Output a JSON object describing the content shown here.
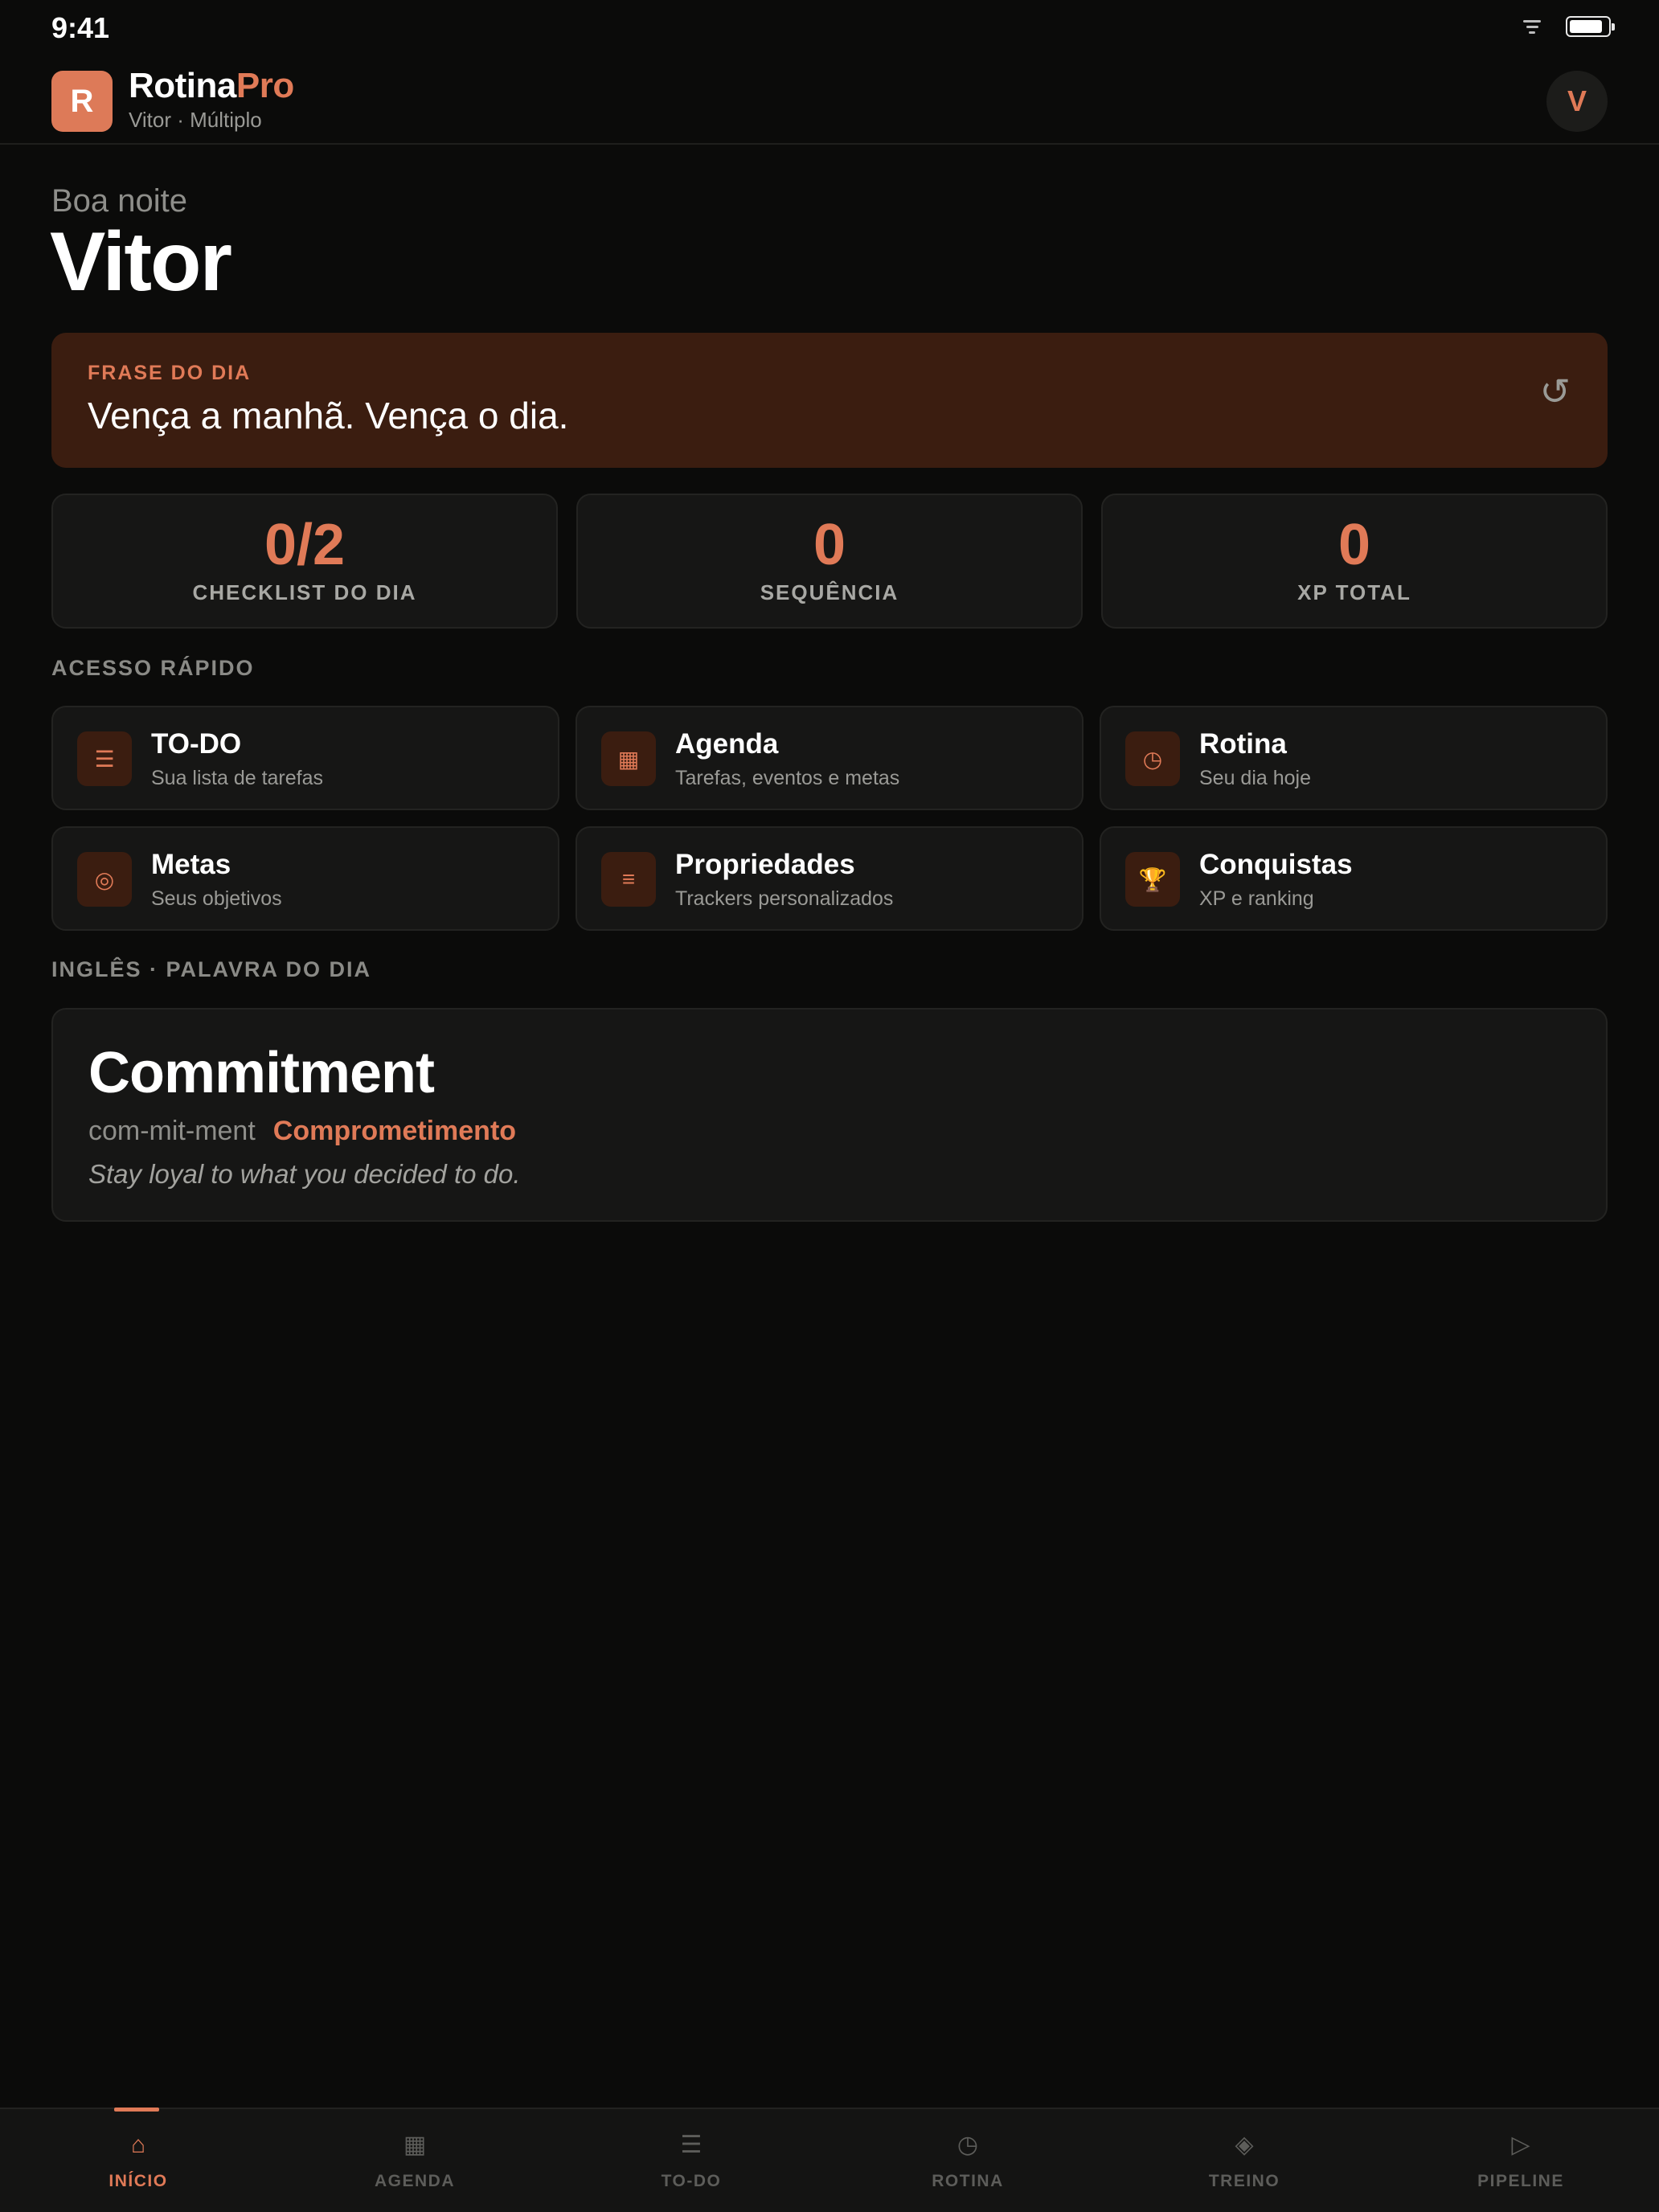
{
  "status_bar": {
    "time": "9:41"
  },
  "header": {
    "logo_letter": "R",
    "title_main": "Rotina",
    "title_accent": "Pro",
    "subtitle": "Vitor · Múltiplo",
    "avatar_letter": "V"
  },
  "greeting": {
    "salutation": "Boa noite",
    "name": "Vitor"
  },
  "quote": {
    "label": "FRASE DO DIA",
    "text": "Vença a manhã. Vença o dia.",
    "refresh_icon": "refresh-icon"
  },
  "stats": [
    {
      "value": "0/2",
      "label": "CHECKLIST DO DIA"
    },
    {
      "value": "0",
      "label": "SEQUÊNCIA"
    },
    {
      "value": "0",
      "label": "XP TOTAL"
    }
  ],
  "quick_access": {
    "label": "ACESSO RÁPIDO",
    "items": [
      {
        "title": "TO-DO",
        "subtitle": "Sua lista de tarefas",
        "icon": "☰"
      },
      {
        "title": "Agenda",
        "subtitle": "Tarefas, eventos e metas",
        "icon": "▦"
      },
      {
        "title": "Rotina",
        "subtitle": "Seu dia hoje",
        "icon": "◷"
      },
      {
        "title": "Metas",
        "subtitle": "Seus objetivos",
        "icon": "◎"
      },
      {
        "title": "Propriedades",
        "subtitle": "Trackers personalizados",
        "icon": "≡"
      },
      {
        "title": "Conquistas",
        "subtitle": "XP e ranking",
        "icon": "🏆"
      }
    ]
  },
  "word_of_day": {
    "label": "INGLÊS · PALAVRA DO DIA",
    "word": "Commitment",
    "pronunciation": "com-mit-ment",
    "translation": "Comprometimento",
    "example": "Stay loyal to what you decided to do."
  },
  "bottom_nav": {
    "active": "INÍCIO",
    "items": [
      {
        "label": "INÍCIO",
        "icon": "⌂"
      },
      {
        "label": "AGENDA",
        "icon": "▦"
      },
      {
        "label": "TO-DO",
        "icon": "☰"
      },
      {
        "label": "ROTINA",
        "icon": "◷"
      },
      {
        "label": "TREINO",
        "icon": "◈"
      },
      {
        "label": "PIPELINE",
        "icon": "▷"
      }
    ]
  },
  "colors": {
    "accent": "#e07a57",
    "background": "#0b0b0a",
    "card": "#161615",
    "quote_bg": "#3b1d10"
  }
}
